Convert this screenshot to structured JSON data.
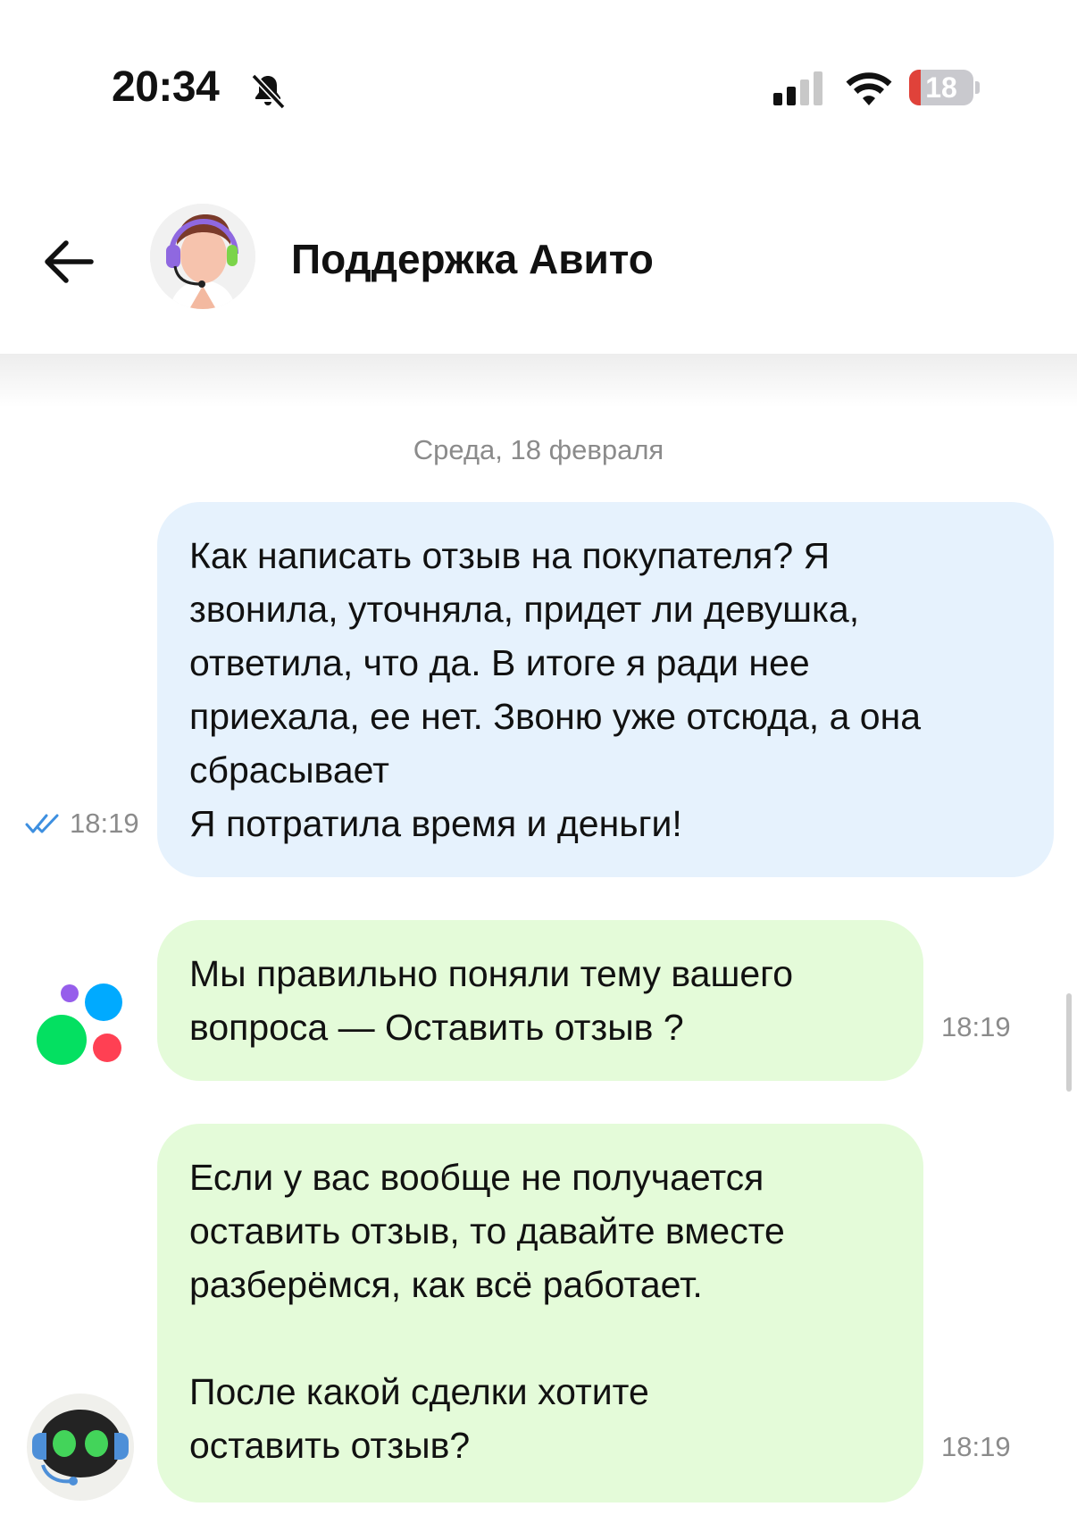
{
  "status_bar": {
    "time": "20:34",
    "silent_icon": "bell-slash-icon",
    "signal_icon": "cellular-signal-icon",
    "wifi_icon": "wifi-icon",
    "battery_level": "18",
    "battery_fraction": 0.18,
    "battery_color": "#e0423a"
  },
  "header": {
    "back_icon": "arrow-left-icon",
    "avatar_icon": "support-agent-avatar",
    "title": "Поддержка Авито"
  },
  "chat": {
    "date_separator": "Среда, 18 февраля",
    "messages": [
      {
        "direction": "outgoing",
        "text": "Как написать отзыв на покупателя? Я\nзвонила, уточняла, придет ли девушка,\nответила, что да. В итоге я ради нее\nприехала, ее нет. Звоню уже отсюда, а она\nсбрасывает\nЯ потратила время и деньги!",
        "time": "18:19",
        "status_icon": "double-check-icon",
        "bubble_color": "#e6f2fd"
      },
      {
        "direction": "incoming",
        "text": "Мы правильно поняли тему вашего\nвопроса — Оставить отзыв ?",
        "time": "18:19",
        "sender_icon": "avito-logo-icon",
        "bubble_color": "#e4fbd9"
      },
      {
        "direction": "incoming",
        "text": "Если у вас вообще не получается\nоставить отзыв, то давайте вместе\nразберёмся, как всё работает.\n\nПосле какой сделки хотите\nоставить отзыв?",
        "time": "18:19",
        "sender_icon": "support-bot-avatar",
        "bubble_color": "#e4fbd9"
      }
    ]
  }
}
